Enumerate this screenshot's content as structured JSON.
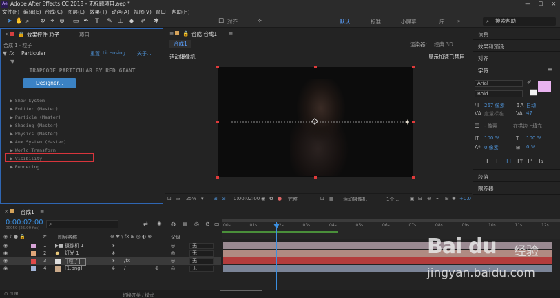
{
  "window": {
    "title": "Adobe After Effects CC 2018 - 无标题项目.aep *",
    "logo": "Ae"
  },
  "menu": [
    "文件(F)",
    "编辑(E)",
    "合成(C)",
    "图层(L)",
    "效果(T)",
    "动画(A)",
    "视图(V)",
    "窗口",
    "帮助(H)"
  ],
  "toolbar": {
    "tools": [
      "selection-tool",
      "hand-tool",
      "zoom-tool",
      "rotate-tool",
      "camera-tool",
      "pan-behind-tool",
      "rectangle-tool",
      "pen-tool",
      "type-tool",
      "brush-tool",
      "clone-stamp-tool",
      "eraser-tool",
      "roto-brush-tool",
      "puppet-tool"
    ],
    "align_label": "对齐",
    "workspaces": [
      "默认",
      "标准",
      "小屏幕",
      "库"
    ],
    "search_placeholder": "搜索帮助"
  },
  "effect_controls": {
    "tab_label": "效果控件 粒子",
    "project_tab": "项目",
    "subtitle": "合成 1 · 粒子",
    "effect_name": "Particular",
    "reset": "重置",
    "licensing": "Licensing...",
    "about": "关于...",
    "brand": "TRAPCODE PARTICULAR BY RED GIANT",
    "designer_button": "Designer...",
    "groups": [
      "Show System",
      "Emitter (Master)",
      "Particle (Master)",
      "Shading (Master)",
      "Physics (Master)",
      "Aux System (Master)",
      "World Transform",
      "Visibility",
      "Rendering"
    ]
  },
  "composition": {
    "tab_label": "合成 合成1",
    "sub_tab": "合成1",
    "renderer_label": "渲染器:",
    "renderer_value": "经典 3D",
    "camera_label": "活动摄像机",
    "accel_label": "显示加速已禁用",
    "zoom": "25%",
    "timecode": "0:00:02:00",
    "quality": "完整",
    "view": "活动摄像机",
    "views": "1个...",
    "exposure": "+0.0"
  },
  "right_panels": {
    "info": "信息",
    "effects_presets": "效果和预设",
    "align": "对齐",
    "character": "字符",
    "font": "Arial",
    "style": "Bold",
    "font_size": "267 像素",
    "leading": "自动",
    "kerning": "度量标准",
    "tracking": "47",
    "stroke": "- 像素",
    "stroke_fill": "在描边上填充",
    "vscale": "100 %",
    "hscale": "100 %",
    "baseline": "0 像素",
    "tsume": "0 %",
    "paragraph": "段落",
    "tracker": "跟踪器",
    "fill_color": "#e9b3f0",
    "stroke_color": "#f2f2f2"
  },
  "timeline": {
    "tab_label": "合成1",
    "timecode": "0:00:02:00",
    "timecode_sub": "00050 (25.00 fps)",
    "col_source": "图层名称",
    "col_parent": "父级",
    "ticks": [
      "00s",
      "01s",
      "02s",
      "03s",
      "04s",
      "05s",
      "06s",
      "07s",
      "08s",
      "09s",
      "10s",
      "11s",
      "12s"
    ],
    "layers": [
      {
        "num": "1",
        "name": "摄像机 1",
        "label_color": "#d6a3d6",
        "parent": "无",
        "bar_color": "#9a8a92"
      },
      {
        "num": "2",
        "name": "灯光 1",
        "label_color": "#e0a678",
        "parent": "无",
        "bar_color": "#b08a82"
      },
      {
        "num": "3",
        "name": "[粒子]",
        "label_color": "#e04a4a",
        "parent": "无",
        "bar_color": "#b33c3c"
      },
      {
        "num": "4",
        "name": "[1.png]",
        "label_color": "#a2b4d6",
        "parent": "无",
        "bar_color": "#7b8497"
      }
    ],
    "status": "切换开关 / 模式"
  },
  "watermark": {
    "logo": "Bai du",
    "cn": "经验",
    "url": "jingyan.baidu.com"
  }
}
